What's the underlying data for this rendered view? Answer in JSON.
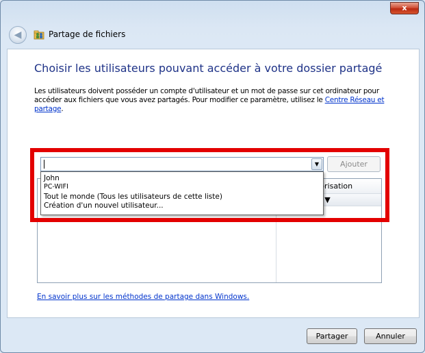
{
  "window": {
    "title": "Partage de fichiers",
    "close_label": "x"
  },
  "heading": "Choisir les utilisateurs pouvant accéder à votre dossier partagé",
  "description": {
    "text": "Les utilisateurs doivent posséder un compte d'utilisateur et un mot de passe sur cet ordinateur pour accéder aux fichiers que vous avez partagés. Pour modifier ce paramètre, utilisez le ",
    "link": "Centre Réseau et partage",
    "end": "."
  },
  "user_input": {
    "value": "",
    "add_button": "Ajouter"
  },
  "dropdown_options": [
    "John",
    "PC-WIFI",
    "Tout le monde (Tous les utilisateurs de cette liste)",
    "Création d'un nouvel utilisateur..."
  ],
  "list": {
    "col_header": "utorisation",
    "col_sub": "e ▼"
  },
  "more_link": "En savoir plus sur les méthodes de partage dans Windows.",
  "footer": {
    "share_button": "Partager",
    "cancel_button": "Annuler"
  },
  "colors": {
    "heading": "#1e3287",
    "link": "#0033cc",
    "highlight": "#e30000"
  }
}
